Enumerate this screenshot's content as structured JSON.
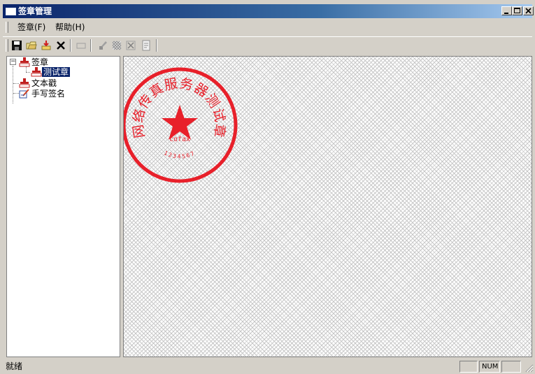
{
  "window": {
    "title": "签章管理"
  },
  "menu": {
    "items": [
      {
        "label": "签章(F)"
      },
      {
        "label": "帮助(H)"
      }
    ]
  },
  "tree": {
    "root": "签章",
    "child_selected": "测试章",
    "item2": "文本戳",
    "item3": "手写签名"
  },
  "seal": {
    "arc_text": "网络传真服务器测试章",
    "center_text": "cofax",
    "bottom_text": "1234567",
    "color": "#e8202a"
  },
  "status": {
    "text": "就绪",
    "num": "NUM"
  },
  "colors": {
    "title_bar": "#0a246a",
    "selection": "#0a246a",
    "seal": "#e8202a"
  }
}
